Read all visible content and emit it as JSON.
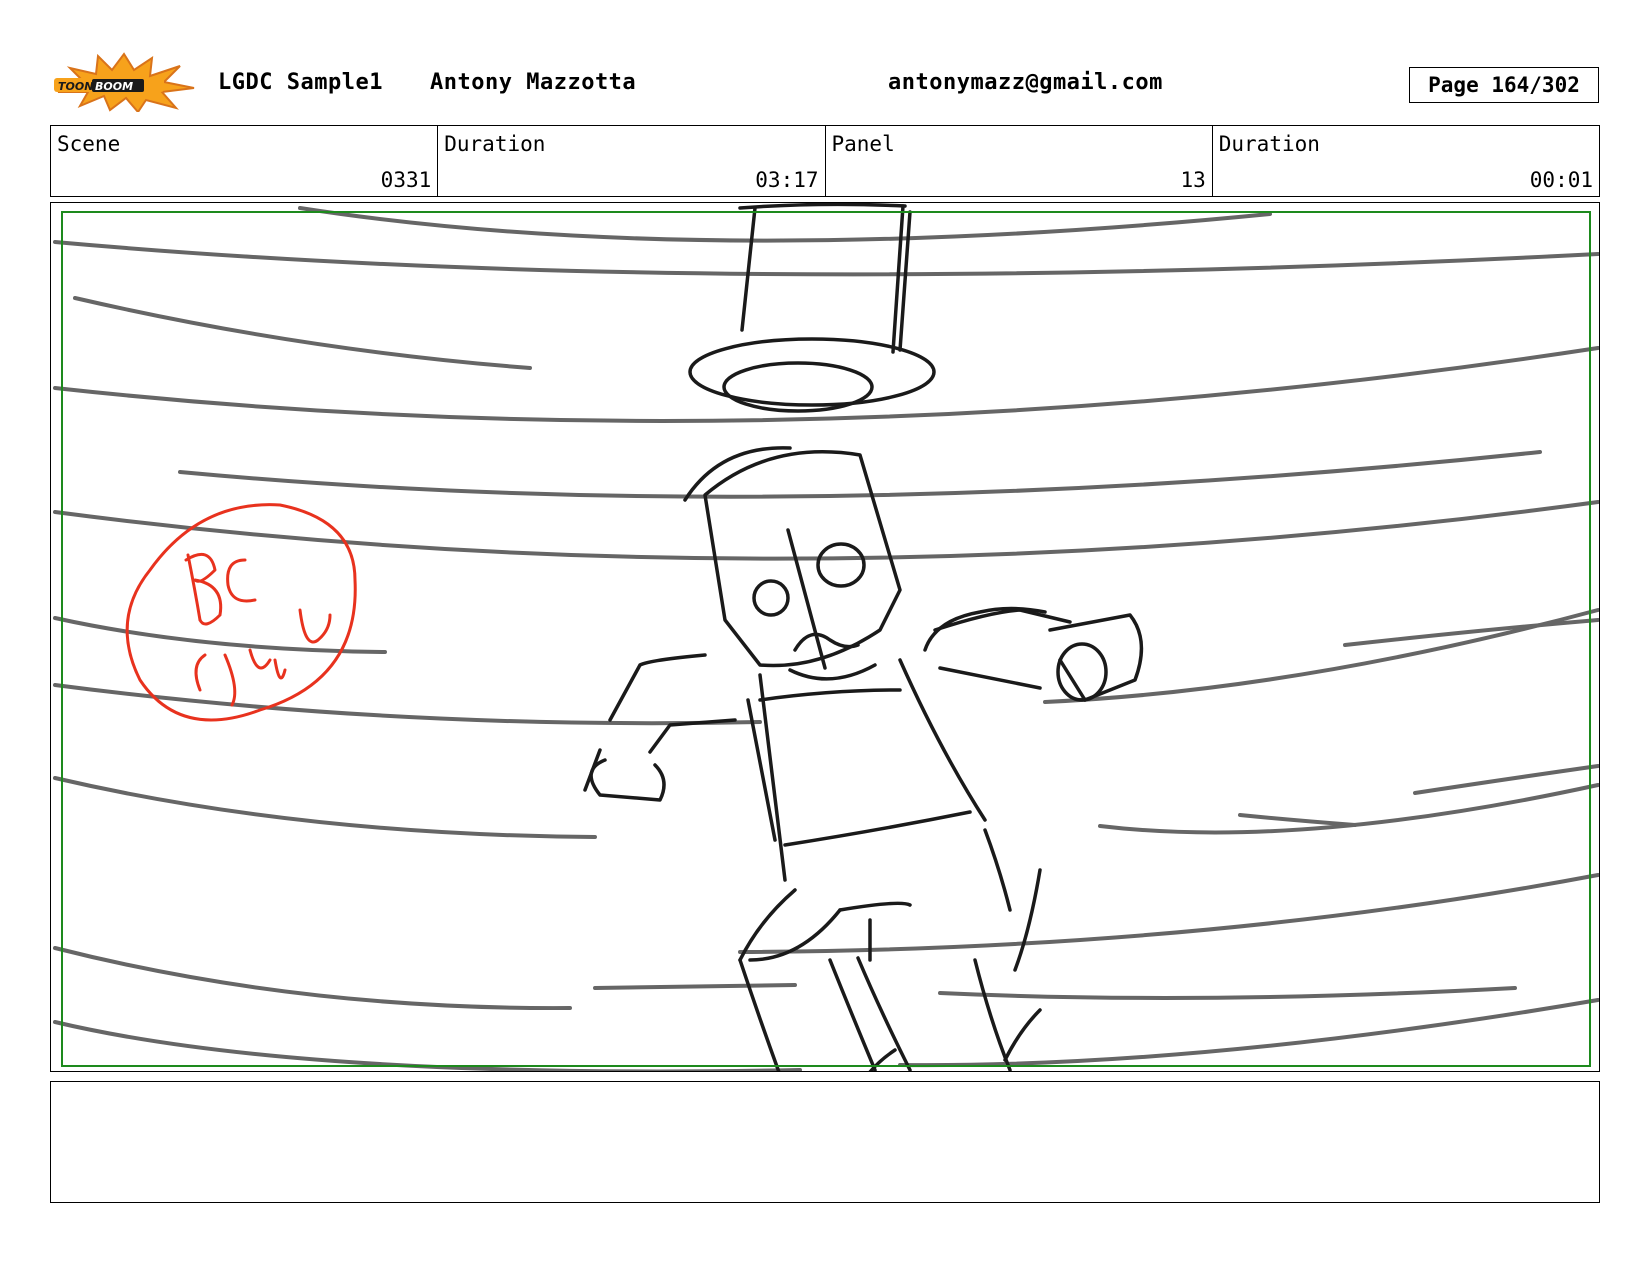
{
  "header": {
    "project": "LGDC Sample1",
    "author": "Antony Mazzotta",
    "email": "antonymazz@gmail.com",
    "page": "Page 164/302",
    "logo_text": "TOONBOOM"
  },
  "info": {
    "scene_label": "Scene",
    "scene_value": "0331",
    "duration_label": "Duration",
    "duration_value": "03:17",
    "panel_label": "Panel",
    "panel_value": "13",
    "panel_duration_label": "Duration",
    "panel_duration_value": "00:01"
  },
  "sketch": {
    "annotation": "BG cycle",
    "annotation_color": "#e8321e",
    "line_color": "#666666",
    "ink_color": "#1a1a1a",
    "safe_frame_color": "#1d8a1d"
  },
  "notes": {
    "text": ""
  }
}
